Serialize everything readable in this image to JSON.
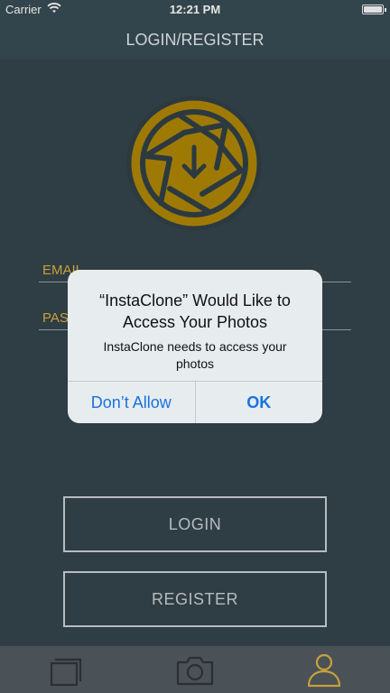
{
  "status_bar": {
    "carrier": "Carrier",
    "time": "12:21 PM",
    "wifi_icon": "wifi-icon",
    "battery_icon": "battery-icon"
  },
  "nav": {
    "title": "LOGIN/REGISTER"
  },
  "logo": {
    "icon": "aperture-download-icon",
    "color": "#9e7a05"
  },
  "form": {
    "email_label": "EMAIL",
    "password_label": "PASSWORD"
  },
  "buttons": {
    "login": "LOGIN",
    "register": "REGISTER"
  },
  "alert": {
    "title": "“InstaClone” Would Like to Access Your Photos",
    "message": "InstaClone needs to access your photos",
    "dont_allow": "Don’t Allow",
    "ok": "OK"
  },
  "tab_bar": {
    "tabs": [
      {
        "icon": "photos-stack-icon"
      },
      {
        "icon": "camera-icon"
      },
      {
        "icon": "profile-icon",
        "selected": true
      }
    ],
    "accent": "#c7a13a"
  }
}
